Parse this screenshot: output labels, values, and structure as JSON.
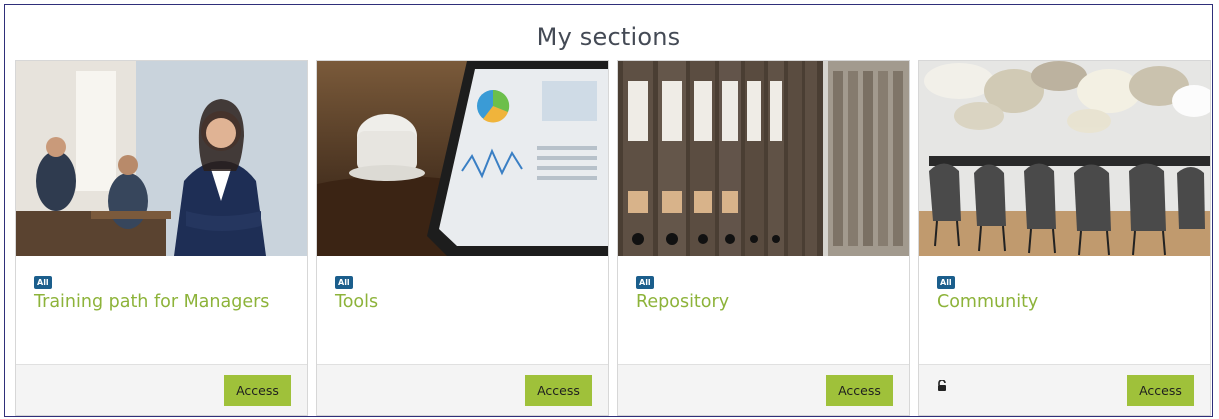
{
  "page": {
    "title": "My sections"
  },
  "cards": [
    {
      "badge": "All",
      "title": "Training path for Managers",
      "button": "Access",
      "image": "business-woman-photo",
      "locked": false
    },
    {
      "badge": "All",
      "title": "Tools",
      "button": "Access",
      "image": "tablet-dashboard-photo",
      "locked": false
    },
    {
      "badge": "All",
      "title": "Repository",
      "button": "Access",
      "image": "binders-shelf-photo",
      "locked": false
    },
    {
      "badge": "All",
      "title": "Community",
      "button": "Access",
      "image": "meeting-room-photo",
      "locked": true,
      "lock_icon": "unlock-icon"
    }
  ],
  "colors": {
    "accent": "#9fc13a",
    "title_text": "#8db33a",
    "badge_bg": "#1b5e8c",
    "frame_border": "#2f2f7a"
  }
}
